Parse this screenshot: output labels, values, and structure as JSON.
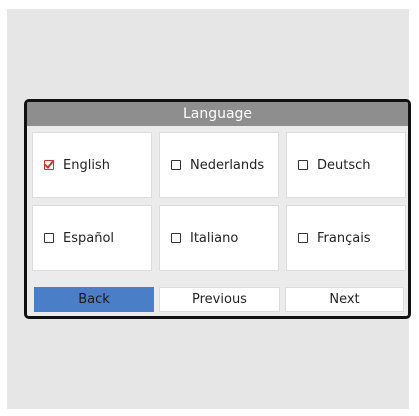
{
  "panel": {
    "title": "Language"
  },
  "languages": [
    {
      "label": "English",
      "checked": true
    },
    {
      "label": "Nederlands",
      "checked": false
    },
    {
      "label": "Deutsch",
      "checked": false
    },
    {
      "label": "Español",
      "checked": false
    },
    {
      "label": "Italiano",
      "checked": false
    },
    {
      "label": "Français",
      "checked": false
    }
  ],
  "nav": {
    "back_label": "Back",
    "previous_label": "Previous",
    "next_label": "Next"
  },
  "colors": {
    "header_bg": "#8e8e8e",
    "back_button_bg": "#4a7fc8",
    "checkbox_checked": "#c0392b"
  }
}
